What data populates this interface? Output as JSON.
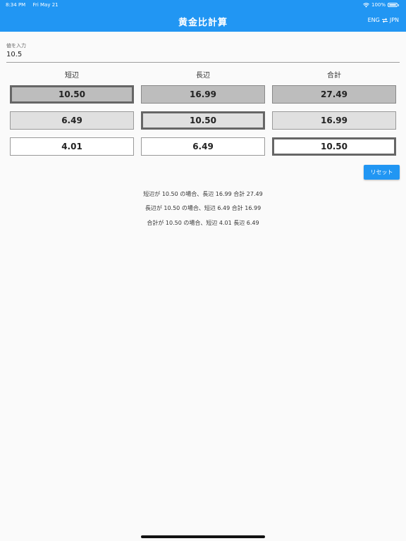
{
  "status_bar": {
    "time": "8:34 PM",
    "date": "Fri May 21",
    "battery": "100%"
  },
  "app_bar": {
    "title": "黄金比計算",
    "lang_left": "ENG",
    "lang_right": "JPN",
    "color": "#2196f3"
  },
  "input": {
    "label": "値を入力",
    "value": "10.5"
  },
  "columns": [
    "短辺",
    "長辺",
    "合計"
  ],
  "rows": [
    [
      "10.50",
      "16.99",
      "27.49"
    ],
    [
      "6.49",
      "10.50",
      "16.99"
    ],
    [
      "4.01",
      "6.49",
      "10.50"
    ]
  ],
  "reset_label": "リセット",
  "summary": [
    "短辺が 10.50 の場合、長辺 16.99 合計 27.49",
    "長辺が 10.50 の場合、短辺 6.49 合計 16.99",
    "合計が 10.50 の場合、短辺 4.01 長辺 6.49"
  ]
}
